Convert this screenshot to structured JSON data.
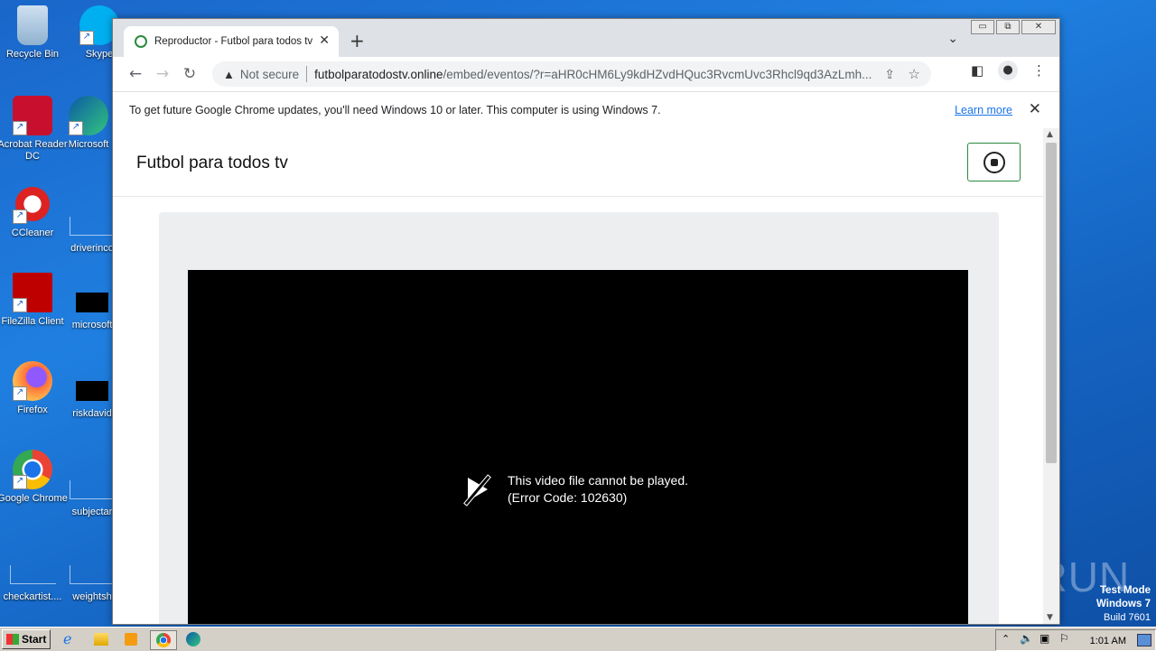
{
  "desktop": {
    "icons": [
      {
        "label": "Recycle Bin",
        "icon": "recycle-bin-icon"
      },
      {
        "label": "Acrobat Reader DC",
        "icon": "acrobat-icon"
      },
      {
        "label": "CCleaner",
        "icon": "ccleaner-icon"
      },
      {
        "label": "FileZilla Client",
        "icon": "filezilla-icon"
      },
      {
        "label": "Firefox",
        "icon": "firefox-icon"
      },
      {
        "label": "Google Chrome",
        "icon": "chrome-icon"
      },
      {
        "label": "checkartist....",
        "icon": "file-icon"
      },
      {
        "label": "Skype",
        "icon": "skype-icon"
      },
      {
        "label": "Microsoft",
        "icon": "edge-icon"
      },
      {
        "label": "driverinco",
        "icon": "file-icon"
      },
      {
        "label": "microsoft",
        "icon": "file-icon"
      },
      {
        "label": "riskdavid",
        "icon": "file-icon"
      },
      {
        "label": "subjectar",
        "icon": "file-icon"
      },
      {
        "label": "weightsh",
        "icon": "file-icon"
      }
    ],
    "watermark": "ANY RUN",
    "test_mode": {
      "line1": "Test Mode",
      "line2": "Windows 7",
      "line3": "Build 7601"
    }
  },
  "browser": {
    "tab": {
      "title": "Reproductor - Futbol para todos tv",
      "close": "✕"
    },
    "new_tab": "+",
    "omnibox": {
      "security": "Not secure",
      "host": "futbolparatodostv.online",
      "path": "/embed/eventos/?r=aHR0cHM6Ly9kdHZvdHQuc3RvcmUvc3Rhcl9qd3AzLmh..."
    },
    "infobar": {
      "message": "To get future Google Chrome updates, you'll need Windows 10 or later. This computer is using Windows 7.",
      "link": "Learn more"
    },
    "window_controls": {
      "minimize": "▭",
      "maximize": "⧉",
      "close": "✕"
    }
  },
  "page": {
    "site_title": "Futbol para todos tv",
    "player": {
      "error_line1": "This video file cannot be played.",
      "error_line2": "(Error Code: 102630)"
    }
  },
  "taskbar": {
    "start": "Start",
    "clock": "1:01 AM"
  },
  "colors": {
    "accent_green": "#2b8a3e",
    "link_blue": "#1a73e8",
    "desktop_blue": "#1f7fe0"
  }
}
